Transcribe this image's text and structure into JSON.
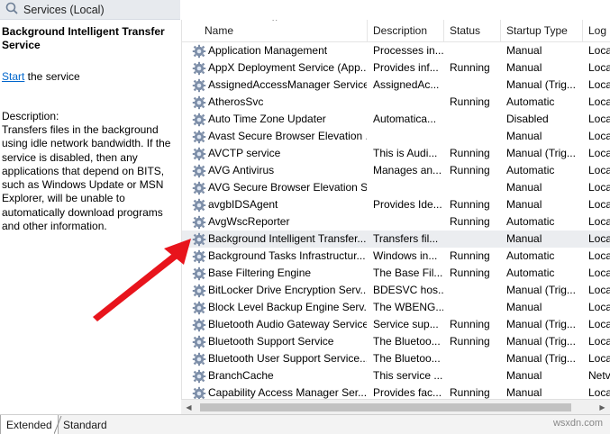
{
  "window": {
    "title": "Services (Local)"
  },
  "detail": {
    "service_title": "Background Intelligent Transfer Service",
    "start_link": "Start",
    "start_suffix": " the service",
    "description_label": "Description:",
    "description_text": "Transfers files in the background using idle network bandwidth. If the service is disabled, then any applications that depend on BITS, such as Windows Update or MSN Explorer, will be unable to automatically download programs and other information."
  },
  "columns": {
    "name": "Name",
    "description": "Description",
    "status": "Status",
    "startup_type": "Startup Type",
    "log_on_as": "Log"
  },
  "services": [
    {
      "name": "Application Management",
      "description": "Processes in...",
      "status": "",
      "startup": "Manual",
      "logon": "Loca"
    },
    {
      "name": "AppX Deployment Service (App...",
      "description": "Provides inf...",
      "status": "Running",
      "startup": "Manual",
      "logon": "Loca"
    },
    {
      "name": "AssignedAccessManager Service",
      "description": "AssignedAc...",
      "status": "",
      "startup": "Manual (Trig...",
      "logon": "Loca"
    },
    {
      "name": "AtherosSvc",
      "description": "",
      "status": "Running",
      "startup": "Automatic",
      "logon": "Loca"
    },
    {
      "name": "Auto Time Zone Updater",
      "description": "Automatica...",
      "status": "",
      "startup": "Disabled",
      "logon": "Loca"
    },
    {
      "name": "Avast Secure Browser Elevation ...",
      "description": "",
      "status": "",
      "startup": "Manual",
      "logon": "Loca"
    },
    {
      "name": "AVCTP service",
      "description": "This is Audi...",
      "status": "Running",
      "startup": "Manual (Trig...",
      "logon": "Loca"
    },
    {
      "name": "AVG Antivirus",
      "description": "Manages an...",
      "status": "Running",
      "startup": "Automatic",
      "logon": "Loca"
    },
    {
      "name": "AVG Secure Browser Elevation S...",
      "description": "",
      "status": "",
      "startup": "Manual",
      "logon": "Loca"
    },
    {
      "name": "avgbIDSAgent",
      "description": "Provides Ide...",
      "status": "Running",
      "startup": "Manual",
      "logon": "Loca"
    },
    {
      "name": "AvgWscReporter",
      "description": "",
      "status": "Running",
      "startup": "Automatic",
      "logon": "Loca"
    },
    {
      "name": "Background Intelligent Transfer...",
      "description": "Transfers fil...",
      "status": "",
      "startup": "Manual",
      "logon": "Loca",
      "selected": true
    },
    {
      "name": "Background Tasks Infrastructur...",
      "description": "Windows in...",
      "status": "Running",
      "startup": "Automatic",
      "logon": "Loca"
    },
    {
      "name": "Base Filtering Engine",
      "description": "The Base Fil...",
      "status": "Running",
      "startup": "Automatic",
      "logon": "Loca"
    },
    {
      "name": "BitLocker Drive Encryption Serv...",
      "description": "BDESVC hos...",
      "status": "",
      "startup": "Manual (Trig...",
      "logon": "Loca"
    },
    {
      "name": "Block Level Backup Engine Serv...",
      "description": "The WBENG...",
      "status": "",
      "startup": "Manual",
      "logon": "Loca"
    },
    {
      "name": "Bluetooth Audio Gateway Service",
      "description": "Service sup...",
      "status": "Running",
      "startup": "Manual (Trig...",
      "logon": "Loca"
    },
    {
      "name": "Bluetooth Support Service",
      "description": "The Bluetoo...",
      "status": "Running",
      "startup": "Manual (Trig...",
      "logon": "Loca"
    },
    {
      "name": "Bluetooth User Support Service...",
      "description": "The Bluetoo...",
      "status": "",
      "startup": "Manual (Trig...",
      "logon": "Loca"
    },
    {
      "name": "BranchCache",
      "description": "This service ...",
      "status": "",
      "startup": "Manual",
      "logon": "Netv"
    },
    {
      "name": "Capability Access Manager Ser...",
      "description": "Provides fac...",
      "status": "Running",
      "startup": "Manual",
      "logon": "Loca"
    }
  ],
  "tabs": [
    {
      "label": "Extended",
      "active": true
    },
    {
      "label": "Standard",
      "active": false
    }
  ],
  "watermark": "wsxdn.com",
  "colors": {
    "selected_row": "#ebedf0",
    "link": "#0066cc",
    "annotation_arrow": "#e8141c"
  }
}
